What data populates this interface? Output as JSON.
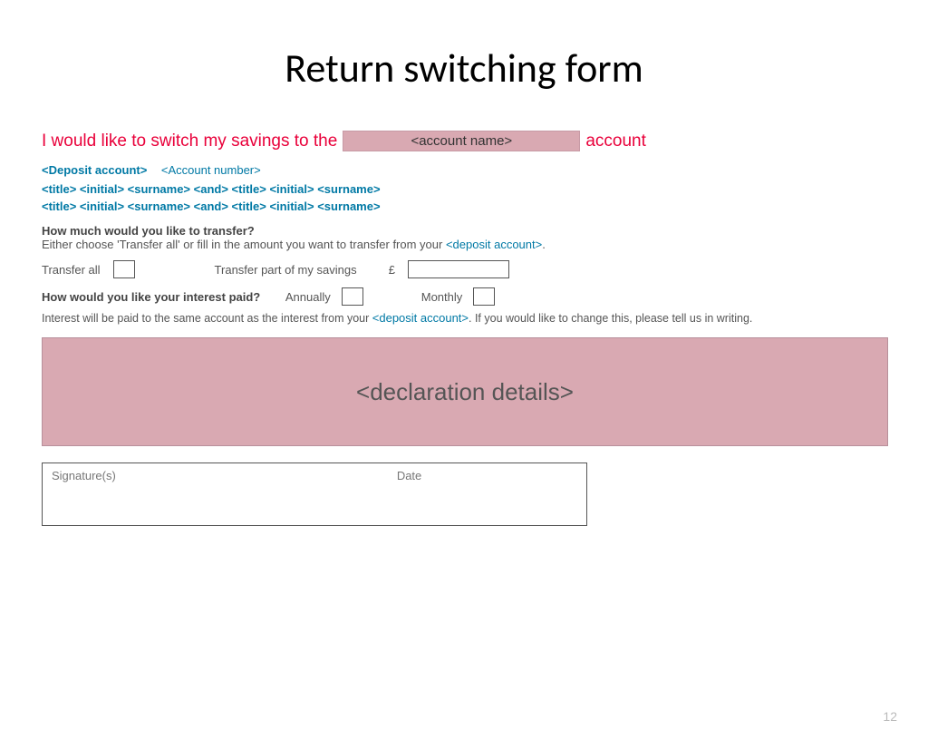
{
  "title": "Return switching form",
  "switch": {
    "prefix": "I would like to switch my savings to the",
    "account_name_ph": "<account   name>",
    "suffix": "account"
  },
  "deposit_line": {
    "deposit_ph": "<Deposit account>",
    "acct_num_ph": "<Account number>"
  },
  "name_rows": [
    "<title> <initial> <surname> <and> <title> <initial> <surname>",
    "<title> <initial> <surname> <and> <title> <initial> <surname>"
  ],
  "transfer": {
    "question": "How much would you like to transfer?",
    "help_pre": "Either choose 'Transfer all' or fill in the amount you want to transfer from your ",
    "help_ph": "<deposit account>",
    "help_post": ".",
    "transfer_all_label": "Transfer all",
    "transfer_part_label": "Transfer part of my savings",
    "currency": "£"
  },
  "interest": {
    "question": "How would you like your interest paid?",
    "annually_label": "Annually",
    "monthly_label": "Monthly",
    "note_pre": "Interest will be paid to the same account as the interest from your ",
    "note_ph": "<deposit account>",
    "note_post": ". If you would like to change this, please tell us in writing."
  },
  "declaration_ph": "<declaration details>",
  "sig": {
    "signature_label": "Signature(s)",
    "date_label": "Date"
  },
  "page_number": "12"
}
